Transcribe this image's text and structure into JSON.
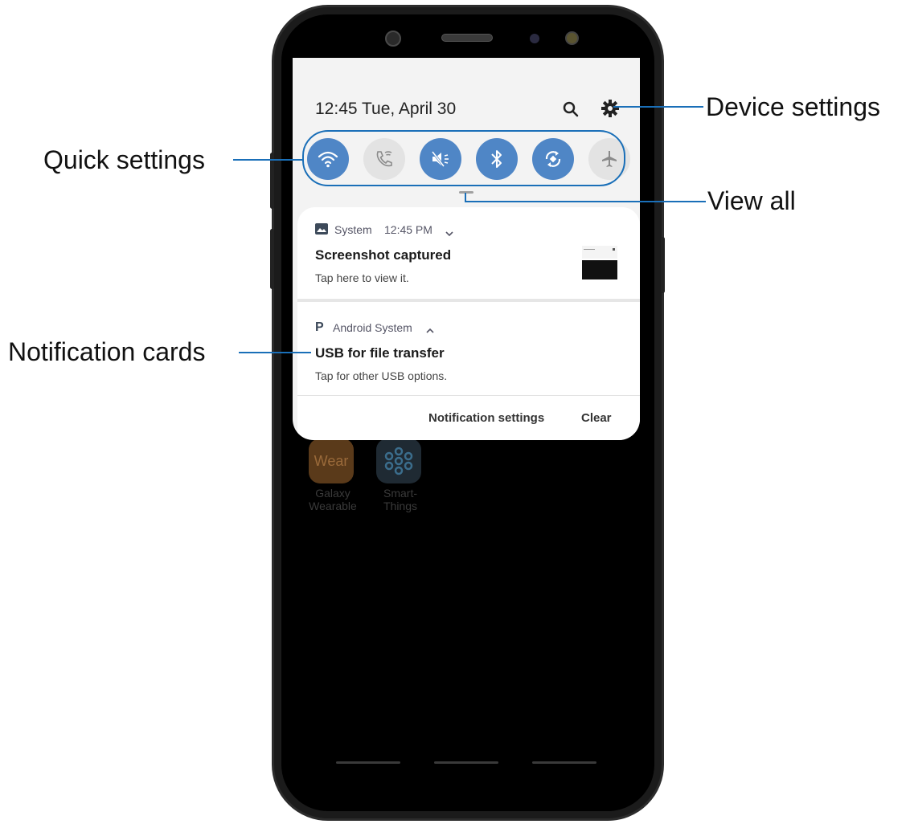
{
  "status": {
    "time_date": "12:45  Tue, April 30"
  },
  "quick_settings": {
    "toggles": [
      {
        "name": "wifi",
        "state": "on"
      },
      {
        "name": "wifi-calling",
        "state": "off"
      },
      {
        "name": "sound-mute",
        "state": "on"
      },
      {
        "name": "bluetooth",
        "state": "on"
      },
      {
        "name": "auto-rotate",
        "state": "on"
      },
      {
        "name": "airplane-mode",
        "state": "off"
      }
    ]
  },
  "notifications": [
    {
      "app": "System",
      "time": "12:45 PM",
      "title": "Screenshot captured",
      "body": "Tap here to view it."
    },
    {
      "app": "Android System",
      "time": "",
      "title": "USB for file transfer",
      "body": "Tap for other USB options."
    }
  ],
  "actions": {
    "settings": "Notification settings",
    "clear": "Clear"
  },
  "home_apps": [
    {
      "icon_text": "Wear",
      "label_line1": "Galaxy",
      "label_line2": "Wearable"
    },
    {
      "icon_text": "",
      "label_line1": "Smart-",
      "label_line2": "Things"
    }
  ],
  "callouts": {
    "device_settings": "Device settings",
    "quick_settings": "Quick settings",
    "view_all": "View all",
    "notification_cards": "Notification cards"
  },
  "colors": {
    "accent": "#4f86c6",
    "callout_line": "#1a6fb8"
  }
}
